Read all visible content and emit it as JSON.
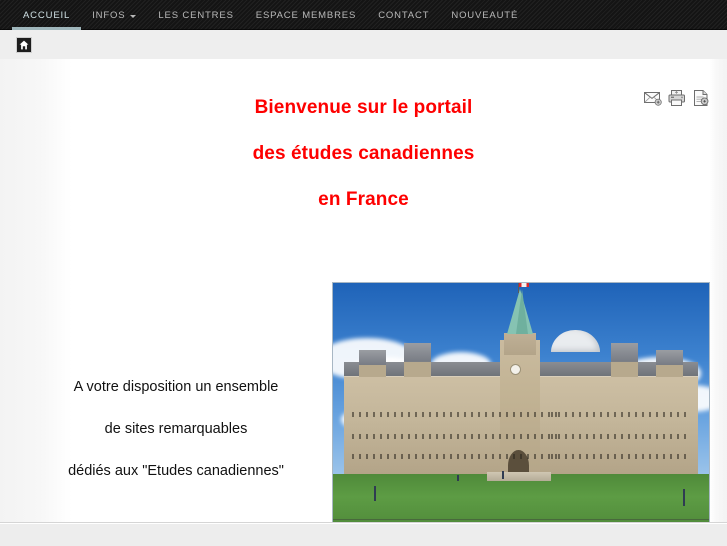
{
  "nav": {
    "items": [
      {
        "label": "ACCUEIL",
        "active": true,
        "has_dropdown": false
      },
      {
        "label": "INFOS",
        "active": false,
        "has_dropdown": true
      },
      {
        "label": "LES CENTRES",
        "active": false,
        "has_dropdown": false
      },
      {
        "label": "ESPACE MEMBRES",
        "active": false,
        "has_dropdown": false
      },
      {
        "label": "CONTACT",
        "active": false,
        "has_dropdown": false
      },
      {
        "label": "NOUVEAUTÉ",
        "active": false,
        "has_dropdown": false
      }
    ]
  },
  "breadcrumb": {
    "home_icon": "home-icon"
  },
  "actions": [
    {
      "icon": "email-icon",
      "title": "Envoyer par e-mail"
    },
    {
      "icon": "print-icon",
      "title": "Imprimer"
    },
    {
      "icon": "page-icon",
      "title": "Page"
    }
  ],
  "headline": {
    "color": "#fe0000",
    "line1": "Bienvenue sur le portail",
    "line2": "des études canadiennes",
    "line3": "en France"
  },
  "blurb": {
    "line1": "A votre disposition un ensemble",
    "line2": "de sites remarquables",
    "line3": "dédiés aux \"Etudes canadiennes\""
  },
  "photo": {
    "alt": "Parlement du Canada, Colline du Parlement, Ottawa"
  },
  "theme": {
    "nav_background": "#141414",
    "nav_text": "#b9b9b9",
    "nav_active_text": "#cfe0e4",
    "nav_active_underline": "#9fb6bb",
    "crumbbar_background": "#eeeeee",
    "sheet_background": "#ffffff",
    "page_background": "#ededed",
    "body_text": "#111111"
  }
}
